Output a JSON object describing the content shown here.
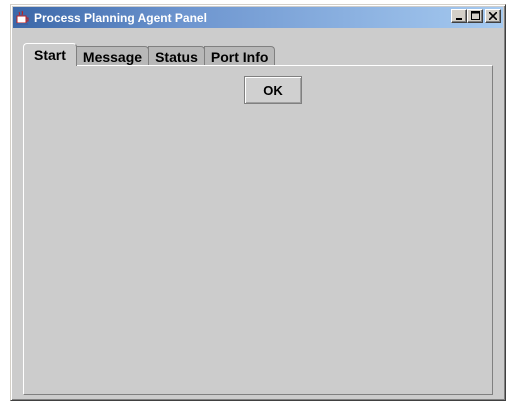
{
  "window": {
    "title": "Process Planning Agent Panel",
    "app_icon": "java-coffee-cup-icon",
    "buttons": {
      "minimize": "minimize-icon",
      "maximize": "maximize-icon",
      "close": "close-icon"
    }
  },
  "tabs": [
    {
      "label": "Start",
      "active": true
    },
    {
      "label": "Message",
      "active": false
    },
    {
      "label": "Status",
      "active": false
    },
    {
      "label": "Port Info",
      "active": false
    }
  ],
  "panel": {
    "ok_label": "OK"
  },
  "colors": {
    "title_gradient_start": "#3b67a8",
    "title_gradient_end": "#a6caf0",
    "background": "#cccccc"
  }
}
